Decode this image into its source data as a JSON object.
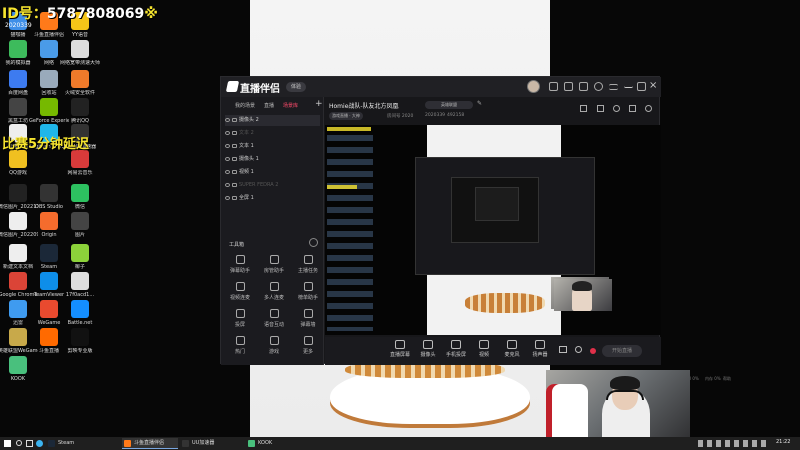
{
  "overlay": {
    "line1_label": "ID号：",
    "line1_number": "5787808069",
    "line1_suffix": "※",
    "date_text": "2020339",
    "line2": "比赛5分钟延迟"
  },
  "desktop_icons": [
    {
      "label": "猫咖播",
      "color": "#3f8fe8"
    },
    {
      "label": "斗鱼直播伴侣",
      "color": "#ff7a1a"
    },
    {
      "label": "YY语音",
      "color": "#f5c518"
    },
    {
      "label": "我的模拟器",
      "color": "#3dbb5c"
    },
    {
      "label": "网络",
      "color": "#4a9be8"
    },
    {
      "label": "网络宽带测速大师",
      "color": "#ddd"
    },
    {
      "label": "百度网盘",
      "color": "#3d7bf0"
    },
    {
      "label": "回收站",
      "color": "#9ab"
    },
    {
      "label": "火绒安全软件",
      "color": "#f07a2a"
    },
    {
      "label": "黑盒工坊",
      "color": "#444"
    },
    {
      "label": "GeForce Experience",
      "color": "#76b900"
    },
    {
      "label": "腾讯QQ",
      "color": "#222"
    },
    {
      "label": "未来营造",
      "color": "#eee"
    },
    {
      "label": "Logitech G HUB",
      "color": "#1fb6e9"
    },
    {
      "label": "网易UU加速器",
      "color": "#333"
    },
    {
      "label": "QQ游戏",
      "color": "#f0c020"
    },
    {
      "label": "网易云音乐",
      "color": "#d83a3a"
    },
    {
      "label": "微信图片_2022111...",
      "color": "#222"
    },
    {
      "label": "OBS Studio",
      "color": "#333"
    },
    {
      "label": "微信",
      "color": "#2dc160"
    },
    {
      "label": "微信图片_2022091...",
      "color": "#eee"
    },
    {
      "label": "Origin",
      "color": "#f56c2d"
    },
    {
      "label": "图片",
      "color": "#444"
    },
    {
      "label": "新建文本文档",
      "color": "#eee"
    },
    {
      "label": "Steam",
      "color": "#1b2838"
    },
    {
      "label": "椰子",
      "color": "#8cd23a"
    },
    {
      "label": "Google Chrome",
      "color": "#db4437"
    },
    {
      "label": "TeamViewer",
      "color": "#0e8ee9"
    },
    {
      "label": "17f0acd1...",
      "color": "#ddd"
    },
    {
      "label": "迅雷",
      "color": "#3f9bf0"
    },
    {
      "label": "WeGame",
      "color": "#e94a2f"
    },
    {
      "label": "Battle.net",
      "color": "#148eff"
    },
    {
      "label": "英雄联盟WeGame版",
      "color": "#c8a94a"
    },
    {
      "label": "斗鱼直播",
      "color": "#ff6a00"
    },
    {
      "label": "剪映专业版",
      "color": "#111"
    },
    {
      "label": "KOOK",
      "color": "#49c07d"
    }
  ],
  "app": {
    "name": "直播伴侣",
    "version_pill": "体验",
    "sidebar_tabs": [
      "我的场景",
      "直播",
      "场景库"
    ],
    "add_label": "+",
    "sources": [
      {
        "label": "摄像头 2",
        "state": "sel"
      },
      {
        "label": "文本 2",
        "state": "dim"
      },
      {
        "label": "文本 1",
        "state": ""
      },
      {
        "label": "摄像头 1",
        "state": ""
      },
      {
        "label": "视频 1",
        "state": ""
      },
      {
        "label": "SUPER FEDRA 2",
        "state": "dim"
      },
      {
        "label": "全屏 1",
        "state": ""
      }
    ],
    "toolbox_title": "工具箱",
    "tools": [
      "弹幕助手",
      "房管助手",
      "主播任务",
      "视频连麦",
      "多人连麦",
      "榜单助手",
      "投屏",
      "语音互动",
      "弹幕墙",
      "热门",
      "游戏",
      "更多"
    ],
    "room_title": "Homie战队-队友北方凤凰",
    "category_pill": "英雄联盟",
    "edit_label": "✎",
    "meta": {
      "category": "游戏直播 · 大神",
      "room_id": "房间号 2020",
      "date": "2020339",
      "viewers": "492158"
    },
    "controls": [
      {
        "label": "直播屏幕",
        "icon": "screen-icon"
      },
      {
        "label": "摄像头",
        "icon": "camera-icon"
      },
      {
        "label": "手机投屏",
        "icon": "phone-cast-icon"
      },
      {
        "label": "视频",
        "icon": "video-icon"
      },
      {
        "label": "麦克风",
        "icon": "mic-icon"
      },
      {
        "label": "扬声器",
        "icon": "speaker-icon"
      }
    ],
    "live_button": "开始直播",
    "stats": [
      "直播时间 00",
      "FPS 60",
      "码率 0kbps",
      "丢帧 0%",
      "CPU 0%",
      "内存 0%",
      "帮助"
    ]
  },
  "taskbar": {
    "tasks": [
      {
        "label": "Steam",
        "color": "#1b2838",
        "active": false
      },
      {
        "label": "斗鱼直播伴侣",
        "color": "#ff7a1a",
        "active": true
      },
      {
        "label": "UU加速器",
        "color": "#333",
        "active": false
      },
      {
        "label": "KOOK",
        "color": "#49c07d",
        "active": false
      }
    ],
    "clock": "21:22"
  }
}
